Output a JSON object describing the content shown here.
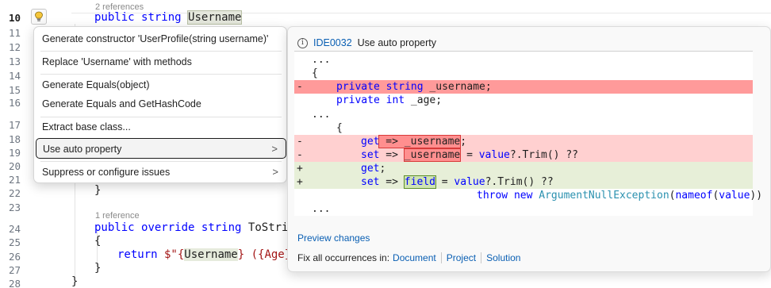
{
  "editor": {
    "codelens_top": "2 references",
    "codelens_mid": "1 reference",
    "line_numbers": [
      "10",
      "11",
      "12",
      "13",
      "14",
      "15",
      "16",
      "17",
      "18",
      "19",
      "20",
      "21",
      "22",
      "23",
      "24",
      "25",
      "26",
      "27",
      "28"
    ],
    "line10": {
      "kw1": "public",
      "kw2": "string",
      "name": "Username"
    },
    "line22": "}",
    "line24": {
      "kw1": "public",
      "kw2": "override",
      "kw3": "string",
      "name": "ToString("
    },
    "line25": "{",
    "line26": {
      "kw": "return",
      "pre": " $\"{",
      "var": "Username",
      "post": "} ({Age})\""
    },
    "line27": "}",
    "line28": "}"
  },
  "quick_actions": {
    "items": [
      {
        "label": "Generate constructor 'UserProfile(string username)'"
      },
      {
        "label": "Replace 'Username' with methods"
      },
      {
        "label": "Generate Equals(object)"
      },
      {
        "label": "Generate Equals and GetHashCode"
      },
      {
        "label": "Extract base class..."
      },
      {
        "label": "Use auto property",
        "has_submenu": true,
        "selected": true
      },
      {
        "label": "Suppress or configure issues",
        "has_submenu": true
      }
    ],
    "chevron": ">"
  },
  "preview": {
    "diagnostic_id": "IDE0032",
    "title": "Use auto property",
    "diff": {
      "l0": "...",
      "l1": "{",
      "l2": {
        "mark": "-",
        "kw1": "private",
        "kw2": "string",
        "rest": " _username;"
      },
      "l3": {
        "kw1": "private",
        "kw2": "int",
        "rest": " _age;"
      },
      "l4": "...",
      "l5": "{",
      "l6": {
        "mark": "-",
        "kw": "get",
        "box": " => _username",
        "rest": ";"
      },
      "l7": {
        "mark": "-",
        "kw": "set",
        "pre": " => ",
        "box": "_username",
        "rest": " = ",
        "kw2": "value",
        "rest2": "?.Trim() ??"
      },
      "l8": {
        "mark": "+",
        "kw": "get",
        "rest": ";"
      },
      "l9": {
        "mark": "+",
        "kw": "set",
        "pre": " => ",
        "box": "field",
        "rest": " = ",
        "kw2": "value",
        "rest2": "?.Trim() ??"
      },
      "l10": {
        "kw1": "throw",
        "kw2": "new",
        "type": "ArgumentNullException",
        "pre": "(",
        "kw3": "nameof",
        "rest": "(",
        "kw4": "value",
        "rest2": "))"
      },
      "l11": "..."
    },
    "preview_changes": "Preview changes",
    "fix_all_label": "Fix all occurrences in:",
    "fix_all_targets": [
      "Document",
      "Project",
      "Solution"
    ]
  },
  "colors": {
    "deleted_line_strong": "#ff9a9a",
    "deleted_line": "#ffd0d0",
    "added_line": "#e7efd8",
    "link": "#0a5fb3",
    "keyword": "#0000ff",
    "type": "#2b91af"
  },
  "icons": [
    "lightbulb-icon",
    "info-icon",
    "chevron-right-icon"
  ]
}
